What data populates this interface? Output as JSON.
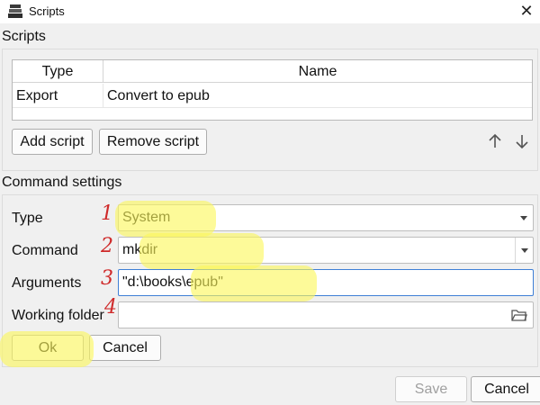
{
  "window": {
    "title": "Scripts",
    "close_glyph": "✕"
  },
  "scripts_group": {
    "title": "Scripts",
    "table": {
      "headers": {
        "type": "Type",
        "name": "Name"
      },
      "rows": [
        {
          "type": "Export",
          "name": "Convert to epub"
        }
      ]
    },
    "add_label": "Add script",
    "remove_label": "Remove script",
    "up_icon": "arrow-up-icon",
    "down_icon": "arrow-down-icon"
  },
  "command_group": {
    "title": "Command settings",
    "type": {
      "label": "Type",
      "value": "System",
      "annotation": "1"
    },
    "command": {
      "label": "Command",
      "value": "mkdir",
      "annotation": "2"
    },
    "arguments": {
      "label": "Arguments",
      "value": "\"d:\\books\\epub\"",
      "annotation": "3"
    },
    "working_folder": {
      "label": "Working folder",
      "value": "",
      "annotation": "4"
    },
    "ok_label": "Ok",
    "cancel_label": "Cancel"
  },
  "footer": {
    "save_label": "Save",
    "cancel_label": "Cancel"
  },
  "colors": {
    "highlight": "#fcf75a",
    "annotation": "#cf2a2a",
    "focus_border": "#3f7fd6",
    "client_bg": "#f0f0f0"
  }
}
